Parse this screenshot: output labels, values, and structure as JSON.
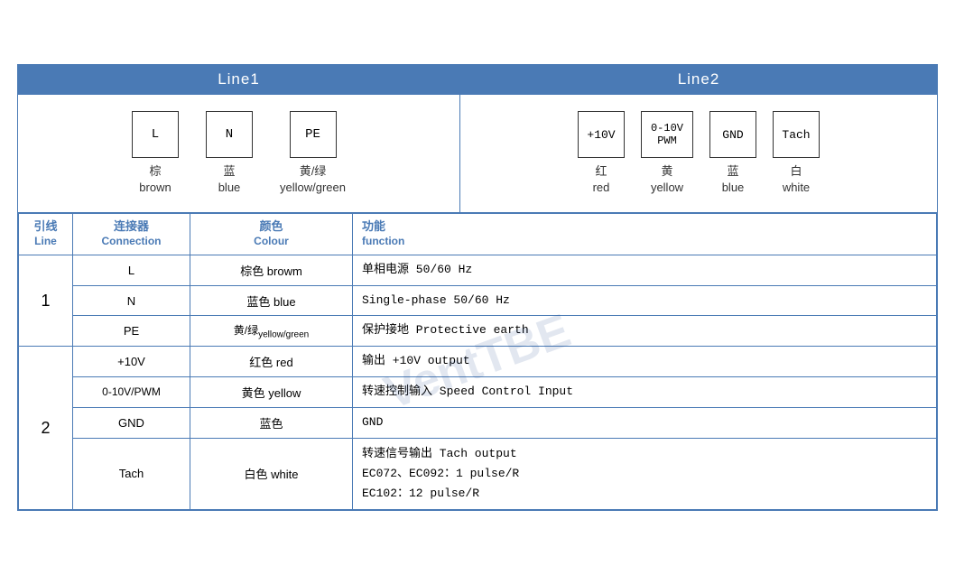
{
  "header": {
    "line1_label": "Line1",
    "line2_label": "Line2"
  },
  "diagram": {
    "line1_connectors": [
      {
        "id": "L",
        "label_zh": "棕",
        "label_en": "brown"
      },
      {
        "id": "N",
        "label_zh": "蓝",
        "label_en": "blue"
      },
      {
        "id": "PE",
        "label_zh": "黄/绿",
        "label_en": "yellow/green"
      }
    ],
    "line2_connectors": [
      {
        "id": "+10V",
        "label_zh": "红",
        "label_en": "red"
      },
      {
        "id": "0-10V\nPWM",
        "label_zh": "黄",
        "label_en": "yellow"
      },
      {
        "id": "GND",
        "label_zh": "蓝",
        "label_en": "blue"
      },
      {
        "id": "Tach",
        "label_zh": "白",
        "label_en": "white"
      }
    ]
  },
  "table": {
    "col_line_zh": "引线",
    "col_line_en": "Line",
    "col_conn_zh": "连接器",
    "col_conn_en": "Connection",
    "col_colour_zh": "颜色",
    "col_colour_en": "Colour",
    "col_func_zh": "功能",
    "col_func_en": "function",
    "rows": [
      {
        "line": "1",
        "connections": [
          {
            "conn": "L",
            "colour_zh": "棕色",
            "colour_en": "browm",
            "func": "单相电源 50/60 Hz"
          },
          {
            "conn": "N",
            "colour_zh": "蓝色",
            "colour_en": "blue",
            "func": "Single-phase 50/60 Hz"
          },
          {
            "conn": "PE",
            "colour_zh": "黄/绿",
            "colour_en": "yellow/green",
            "func": "保护接地 Protective earth"
          }
        ]
      },
      {
        "line": "2",
        "connections": [
          {
            "conn": "+10V",
            "colour_zh": "红色",
            "colour_en": "red",
            "func": "输出 +10V output"
          },
          {
            "conn": "0-10V/PWM",
            "colour_zh": "黄色",
            "colour_en": "yellow",
            "func": "转速控制输入 Speed Control Input"
          },
          {
            "conn": "GND",
            "colour_zh": "蓝色",
            "colour_en": "",
            "func": "GND"
          },
          {
            "conn": "Tach",
            "colour_zh": "白色",
            "colour_en": "white",
            "func": "转速信号输出 Tach output\nEC072、EC092：1 pulse/R\nEC102：12 pulse/R"
          }
        ]
      }
    ]
  },
  "watermark": "VentTBE"
}
